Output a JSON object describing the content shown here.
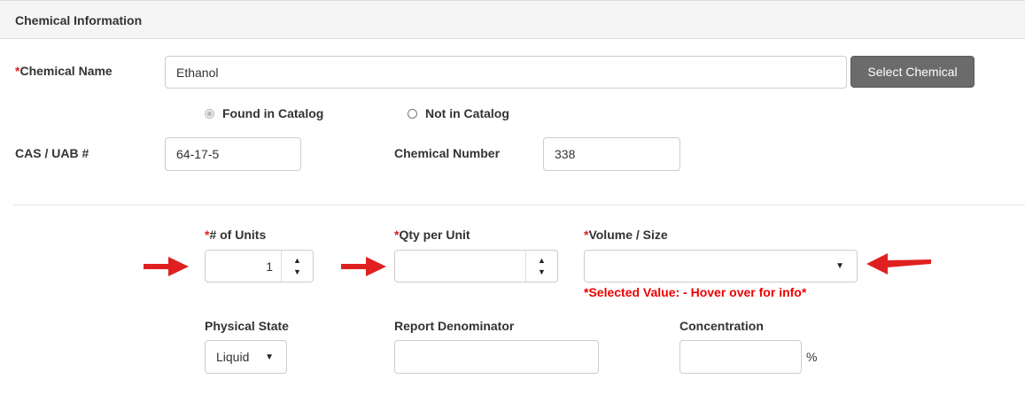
{
  "panel": {
    "title": "Chemical Information"
  },
  "chemical_name": {
    "required": "*",
    "label": "Chemical Name",
    "value": "Ethanol",
    "button": "Select Chemical"
  },
  "catalog": {
    "found": "Found in Catalog",
    "not_found": "Not in Catalog",
    "selected": "found"
  },
  "cas": {
    "label": "CAS / UAB #",
    "value": "64-17-5"
  },
  "chem_number": {
    "label": "Chemical Number",
    "value": "338"
  },
  "units": {
    "required": "*",
    "label": "# of Units",
    "value": "1",
    "up": "▲",
    "down": "▼"
  },
  "qty": {
    "required": "*",
    "label": "Qty per Unit",
    "value": "",
    "up": "▲",
    "down": "▼"
  },
  "volume": {
    "required": "*",
    "label": "Volume / Size",
    "value": "",
    "caret": "▼",
    "note": "*Selected Value: - Hover over for info*"
  },
  "physical_state": {
    "label": "Physical State",
    "value": "Liquid",
    "caret": "▼"
  },
  "report_denominator": {
    "label": "Report Denominator",
    "value": ""
  },
  "concentration": {
    "label": "Concentration",
    "value": "",
    "unit": "%"
  },
  "colors": {
    "annotation_arrow": "#e02020",
    "required": "#e02020"
  }
}
